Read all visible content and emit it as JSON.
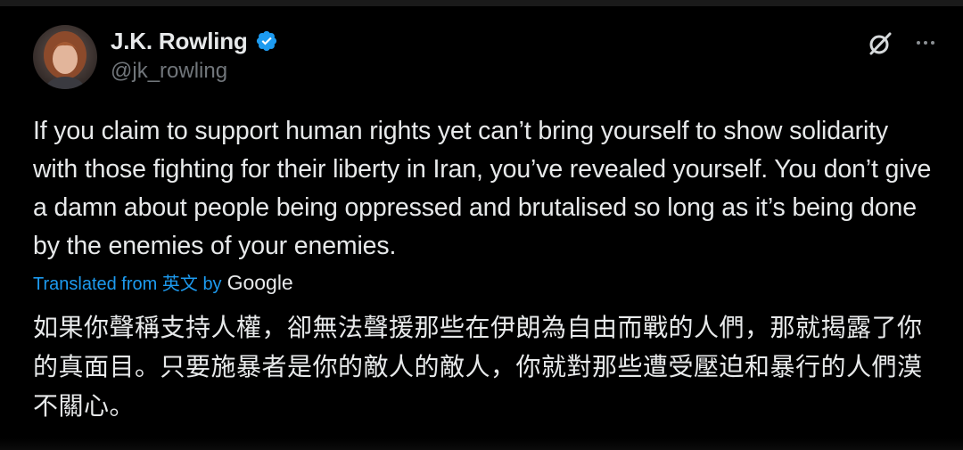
{
  "author": {
    "display_name": "J.K. Rowling",
    "handle": "@jk_rowling",
    "verified": true
  },
  "tweet": {
    "text": "If you claim to support human rights yet can’t bring yourself to show solidarity with those fighting for their liberty in Iran, you’ve revealed yourself. You don’t give a damn about people being oppressed and brutalised so long as it’s being done by the enemies of your enemies.",
    "translation_label_prefix": "Translated from",
    "translation_source_language": "英文",
    "translation_label_by": "by",
    "translation_provider": "Google",
    "translated_text": "如果你聲稱支持人權，卻無法聲援那些在伊朗為自由而戰的人們，那就揭露了你的真面目。只要施暴者是你的敵人的敵人，你就對那些遭受壓迫和暴行的人們漠不關心。"
  },
  "icons": {
    "verified": "verified-badge-icon",
    "grok": "grok-icon",
    "more": "more-options-icon"
  },
  "colors": {
    "background": "#000000",
    "text": "#e7e9ea",
    "secondary_text": "#71767b",
    "accent": "#1d9bf0"
  }
}
